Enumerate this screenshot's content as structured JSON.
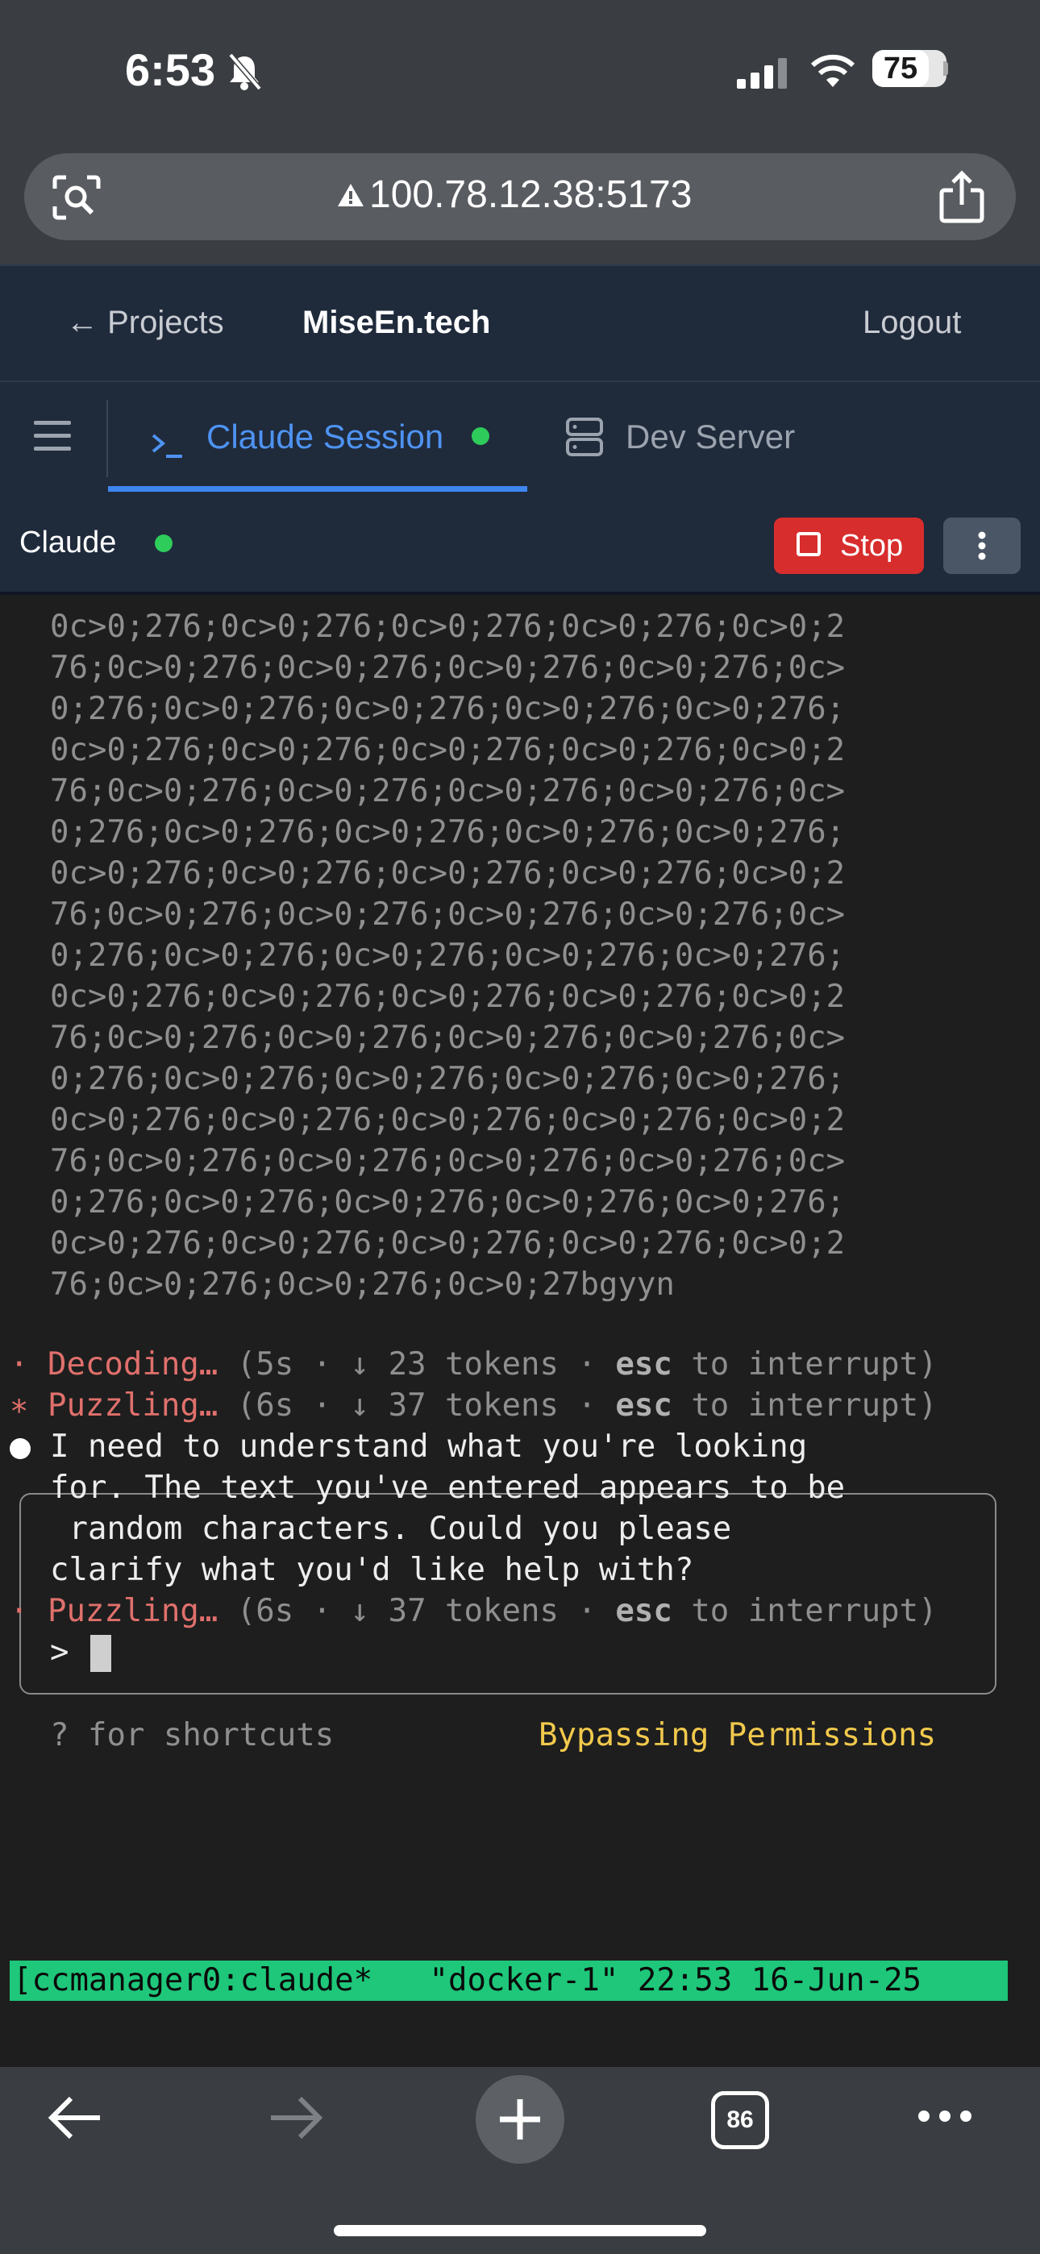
{
  "status": {
    "time": "6:53",
    "battery": "75"
  },
  "browser": {
    "url": "100.78.12.38:5173",
    "tab_count": "86"
  },
  "nav": {
    "back_label": "← Projects",
    "brand": "MiseEn.tech",
    "logout": "Logout"
  },
  "tabs": [
    {
      "label": "Claude Session",
      "active": true,
      "status": "running"
    },
    {
      "label": "Dev Server",
      "active": false
    }
  ],
  "session": {
    "label": "Claude",
    "stop_label": "Stop"
  },
  "terminal": {
    "output_lines": [
      "0c>0;276;0c>0;276;0c>0;276;0c>0;276;0c>0;2",
      "76;0c>0;276;0c>0;276;0c>0;276;0c>0;276;0c>",
      "0;276;0c>0;276;0c>0;276;0c>0;276;0c>0;276;",
      "0c>0;276;0c>0;276;0c>0;276;0c>0;276;0c>0;2",
      "76;0c>0;276;0c>0;276;0c>0;276;0c>0;276;0c>",
      "0;276;0c>0;276;0c>0;276;0c>0;276;0c>0;276;",
      "0c>0;276;0c>0;276;0c>0;276;0c>0;276;0c>0;2",
      "76;0c>0;276;0c>0;276;0c>0;276;0c>0;276;0c>",
      "0;276;0c>0;276;0c>0;276;0c>0;276;0c>0;276;",
      "0c>0;276;0c>0;276;0c>0;276;0c>0;276;0c>0;2",
      "76;0c>0;276;0c>0;276;0c>0;276;0c>0;276;0c>",
      "0;276;0c>0;276;0c>0;276;0c>0;276;0c>0;276;",
      "0c>0;276;0c>0;276;0c>0;276;0c>0;276;0c>0;2",
      "76;0c>0;276;0c>0;276;0c>0;276;0c>0;276;0c>",
      "0;276;0c>0;276;0c>0;276;0c>0;276;0c>0;276;",
      "0c>0;276;0c>0;276;0c>0;276;0c>0;276;0c>0;2",
      "76;0c>0;276;0c>0;276;0c>0;27bgyyn"
    ],
    "status_1": {
      "bullet": "·",
      "verb": "Decoding…",
      "detail_a": " (5s · ↓ 23 tokens · ",
      "key": "esc",
      "detail_b": " to interrupt)"
    },
    "status_2": {
      "bullet": "∗",
      "verb": "Puzzling…",
      "detail_a": " (6s · ↓ 37 tokens · ",
      "key": "esc",
      "detail_b": " to interrupt)"
    },
    "message_lines": [
      "I need to understand what you're looking",
      "for. The text you've entered appears to be",
      " random characters. Could you please",
      "clarify what you'd like help with?"
    ],
    "status_3": {
      "bullet": "·",
      "verb": "Puzzling…",
      "detail_a": " (6s · ↓ 37 tokens · ",
      "key": "esc",
      "detail_b": " to interrupt)"
    },
    "prompt": ">",
    "shortcuts_hint": "? for shortcuts",
    "permissions": "Bypassing Permissions",
    "tmux": "[ccmanager0:claude*   \"docker-1\" 22:53 16-Jun-25"
  },
  "colors": {
    "accent": "#3e86f0",
    "status_green": "#2ecc5b",
    "stop_red": "#d82d2d",
    "tmux_green": "#1ec77a",
    "permissions_yellow": "#f2c94c",
    "spinner_red": "#e0706c"
  },
  "icons": [
    "lens-icon",
    "share-icon",
    "hamburger-icon",
    "terminal-prompt-icon",
    "server-icon",
    "kebab-icon",
    "back-arrow-icon",
    "forward-arrow-icon",
    "plus-icon",
    "tabs-icon",
    "more-dots-icon"
  ]
}
